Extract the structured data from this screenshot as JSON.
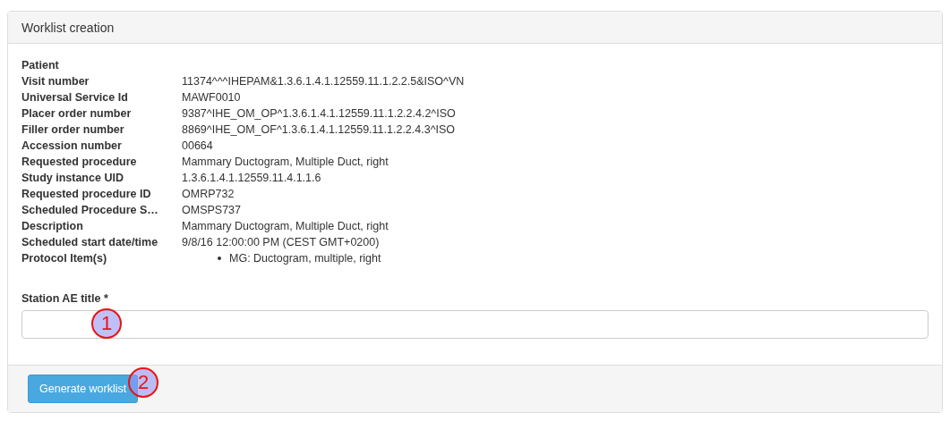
{
  "panel": {
    "title": "Worklist creation",
    "fields": [
      {
        "label": "Patient"
      },
      {
        "label": "Visit number",
        "value": "11374^^^IHEPAM&1.3.6.1.4.1.12559.11.1.2.2.5&ISO^VN"
      },
      {
        "label": "Universal Service Id",
        "value": "MAWF0010"
      },
      {
        "label": "Placer order number",
        "value": "9387^IHE_OM_OP^1.3.6.1.4.1.12559.11.1.2.2.4.2^ISO"
      },
      {
        "label": "Filler order number",
        "value": "8869^IHE_OM_OF^1.3.6.1.4.1.12559.11.1.2.2.4.3^ISO"
      },
      {
        "label": "Accession number",
        "value": "00664"
      },
      {
        "label": "Requested procedure",
        "value": "Mammary Ductogram, Multiple Duct, right"
      },
      {
        "label": "Study instance UID",
        "value": "1.3.6.1.4.1.12559.11.4.1.1.6"
      },
      {
        "label": "Requested procedure ID",
        "value": "OMRP732"
      },
      {
        "label": "Scheduled Procedure S…",
        "value": "OMSPS737"
      },
      {
        "label": "Description",
        "value": "Mammary Ductogram, Multiple Duct, right"
      },
      {
        "label": "Scheduled start date/time",
        "value": "9/8/16 12:00:00 PM (CEST GMT+0200)"
      },
      {
        "label": "Protocol Item(s)",
        "items": [
          "MG: Ductogram, multiple, right"
        ]
      }
    ],
    "station_field": {
      "label": "Station AE title *",
      "callout": "1"
    },
    "button": {
      "label": "Generate worklist",
      "callout": "2"
    }
  }
}
